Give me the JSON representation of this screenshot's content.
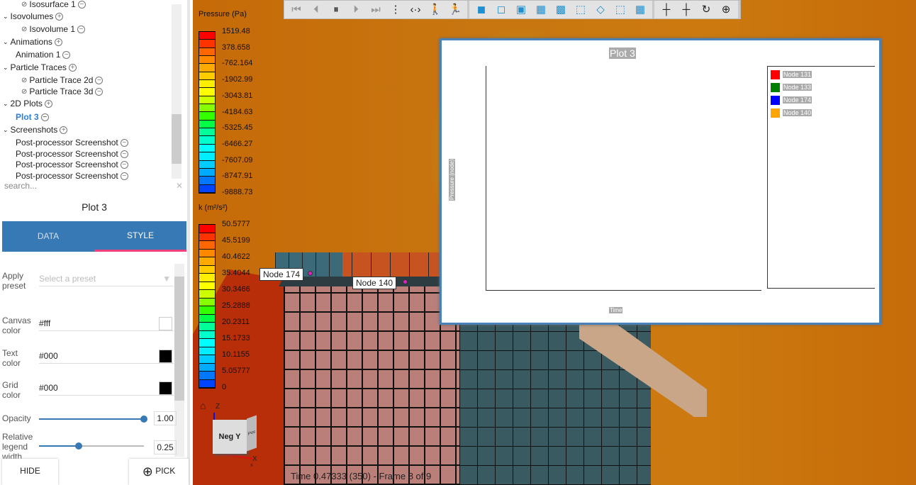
{
  "tree": {
    "items": [
      {
        "label": "Isosurface 1",
        "type": "child",
        "hidden": true
      },
      {
        "label": "Isovolumes",
        "type": "group"
      },
      {
        "label": "Isovolume 1",
        "type": "child",
        "hidden": true
      },
      {
        "label": "Animations",
        "type": "group"
      },
      {
        "label": "Animation 1",
        "type": "child"
      },
      {
        "label": "Particle Traces",
        "type": "group"
      },
      {
        "label": "Particle Trace 2d",
        "type": "child",
        "hidden": true
      },
      {
        "label": "Particle Trace 3d",
        "type": "child",
        "hidden": true
      },
      {
        "label": "2D Plots",
        "type": "group"
      },
      {
        "label": "Plot 3",
        "type": "child",
        "selected": true
      },
      {
        "label": "Screenshots",
        "type": "group"
      },
      {
        "label": "Post-processor Screenshot",
        "type": "child"
      },
      {
        "label": "Post-processor Screenshot",
        "type": "child"
      },
      {
        "label": "Post-processor Screenshot",
        "type": "child"
      },
      {
        "label": "Post-processor Screenshot",
        "type": "child"
      }
    ],
    "search_placeholder": "search..."
  },
  "panel": {
    "title": "Plot 3",
    "tabs": [
      "DATA",
      "STYLE"
    ],
    "active_tab": "STYLE",
    "apply_preset_label": "Apply preset",
    "preset_placeholder": "Select a preset",
    "canvas_color_label": "Canvas color",
    "canvas_color": "#fff",
    "text_color_label": "Text color",
    "text_color": "#000",
    "grid_color_label": "Grid color",
    "grid_color": "#000",
    "opacity_label": "Opacity",
    "opacity": "1.00",
    "opacity_value": 1.0,
    "legend_width_label": "Relative legend width",
    "legend_width": "0.25",
    "legend_width_value": 0.25,
    "hide_label": "HIDE",
    "pick_label": "PICK"
  },
  "toolbar": {
    "icons": [
      "first-frame-icon",
      "prev-frame-icon",
      "pause-icon",
      "next-frame-icon",
      "last-frame-icon",
      "more-icon",
      "fit-icon",
      "walk-icon",
      "run-icon",
      "shaded-icon",
      "shaded-light-icon",
      "shaded-edges-icon",
      "shaded-mesh-icon",
      "shaded-outline-icon",
      "wireframe-icon",
      "outline-icon",
      "points-icon",
      "mesh-icon",
      "probe-point-icon",
      "probe-element-icon",
      "rotate-axis-icon",
      "pick-center-icon"
    ]
  },
  "legend_pressure": {
    "title": "Pressure (Pa)",
    "labels": [
      "1519.48",
      "378.658",
      "-762.164",
      "-1902.99",
      "-3043.81",
      "-4184.63",
      "-5325.45",
      "-6466.27",
      "-7607.09",
      "-8747.91",
      "-9888.73"
    ]
  },
  "legend_k": {
    "title": "k (m²/s²)",
    "labels": [
      "50.5777",
      "45.5199",
      "40.4622",
      "35.4044",
      "30.3466",
      "25.2888",
      "20.2311",
      "15.1733",
      "10.1155",
      "5.05777",
      "0"
    ]
  },
  "nodes": {
    "node174": "Node 174",
    "node140": "Node 140"
  },
  "plot": {
    "title": "Plot 3",
    "ylabel": "Pressure (node)",
    "xlabel": "Time",
    "legend": [
      {
        "name": "Node 131",
        "color": "#ff0000"
      },
      {
        "name": "Node 133",
        "color": "#008000"
      },
      {
        "name": "Node 174",
        "color": "#0000ff"
      },
      {
        "name": "Node 140",
        "color": "#ffa500"
      }
    ]
  },
  "viewcube": {
    "front": "Neg Y",
    "side": "Pos X",
    "z": "Z",
    "x": "X"
  },
  "status": "Time 0.47333 (350) - Frame 8 of 9"
}
